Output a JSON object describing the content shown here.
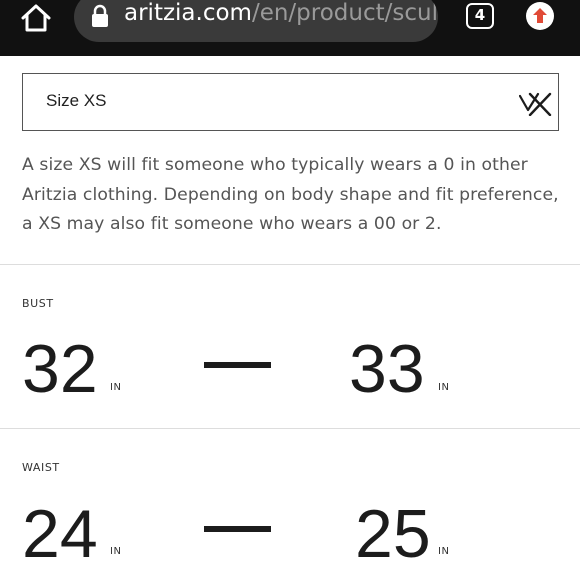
{
  "browser": {
    "url_domain": "aritzia.com",
    "url_path": "/en/product/sculp",
    "tab_count": "4"
  },
  "size_selector": {
    "label": "Size XS"
  },
  "description": "A size XS will fit someone who typically wears a 0 in other Aritzia clothing. Depending on body shape and fit preference, a XS may also fit someone who wears a 00 or 2.",
  "measurements": {
    "bust": {
      "label": "BUST",
      "min": "32",
      "max": "33",
      "unit": "IN"
    },
    "waist": {
      "label": "WAIST",
      "min": "24",
      "max": "25",
      "unit": "IN"
    }
  },
  "colors": {
    "browser_bar": "#111111",
    "url_field": "#3a3a3a",
    "update_arrow": "#e04a36",
    "text_dark": "#1c1c1c",
    "text_muted": "#555555"
  }
}
